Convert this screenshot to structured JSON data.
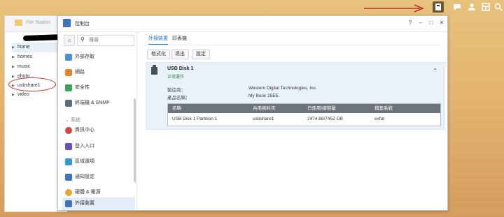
{
  "file_station": {
    "title": "File Station",
    "items": [
      {
        "label": "home",
        "active": true
      },
      {
        "label": "homes"
      },
      {
        "label": "music"
      },
      {
        "label": "photo"
      },
      {
        "label": "usbshare1"
      },
      {
        "label": "video"
      }
    ]
  },
  "control_panel": {
    "title": "控制台",
    "search_placeholder": "搜尋",
    "nav": [
      {
        "label": "外部存取",
        "color": "#4a8fd8"
      },
      {
        "label": "網路",
        "color": "#e3832b"
      },
      {
        "label": "安全性",
        "color": "#3aa55a"
      },
      {
        "label": "終端機 & SNMP",
        "color": "#5a6b7a"
      }
    ],
    "system_section": "系統",
    "system_nav": [
      {
        "label": "資訊中心",
        "color": "#d6453c"
      },
      {
        "label": "登入入口",
        "color": "#6a4ec0"
      },
      {
        "label": "區域選項",
        "color": "#2f9ad8"
      },
      {
        "label": "通知設定",
        "color": "#3d74c0"
      },
      {
        "label": "硬體 & 電源",
        "color": "#e8a23a"
      },
      {
        "label": "外接裝置",
        "color": "#3d74c0",
        "active": true
      }
    ],
    "tabs": [
      "外接裝置",
      "印表機"
    ],
    "buttons": [
      "格式化",
      "退出",
      "設定"
    ],
    "disk": {
      "name": "USB Disk 1",
      "status": "正常運作",
      "manufacturer_label": "製造商：",
      "manufacturer": "Western Digital Technologies, Inc.",
      "product_label": "產品名稱：",
      "product": "My Book 25EE",
      "table": {
        "headers": [
          "名稱",
          "共用資料夾",
          "已使用/總容量",
          "檔案系統"
        ],
        "rows": [
          [
            "USB Disk 1 Partition 1",
            "usbshare1",
            "2474.88/7452 GB",
            "exfat"
          ]
        ]
      }
    },
    "window_buttons": [
      "?",
      "–",
      "□",
      "✕"
    ]
  },
  "annotation_colors": {
    "red": "#c0302b"
  }
}
